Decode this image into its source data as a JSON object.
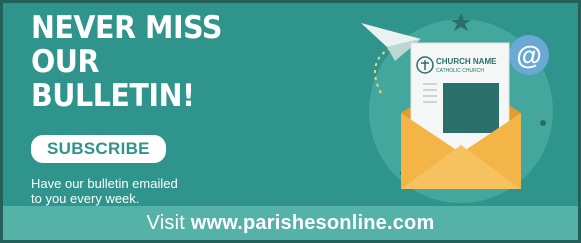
{
  "headline": {
    "line1": "NEVER MISS",
    "line2": "OUR BULLETIN!"
  },
  "subscribe_label": "SUBSCRIBE",
  "blurb": {
    "line1": "Have our bulletin emailed",
    "line2": "to you every week."
  },
  "footer": {
    "visit": "Visit",
    "url": "www.parishesonline.com"
  },
  "letter": {
    "line1": "CHURCH NAME",
    "line2": "CATHOLIC CHURCH"
  },
  "at_symbol": "@",
  "colors": {
    "background": "#2f948b",
    "footer": "#55b2a9",
    "envelope": "#f3b548",
    "envelope_dark": "#e29b2c",
    "letter_block": "#2a6f6a",
    "accent_blue": "#6aa9d6"
  }
}
